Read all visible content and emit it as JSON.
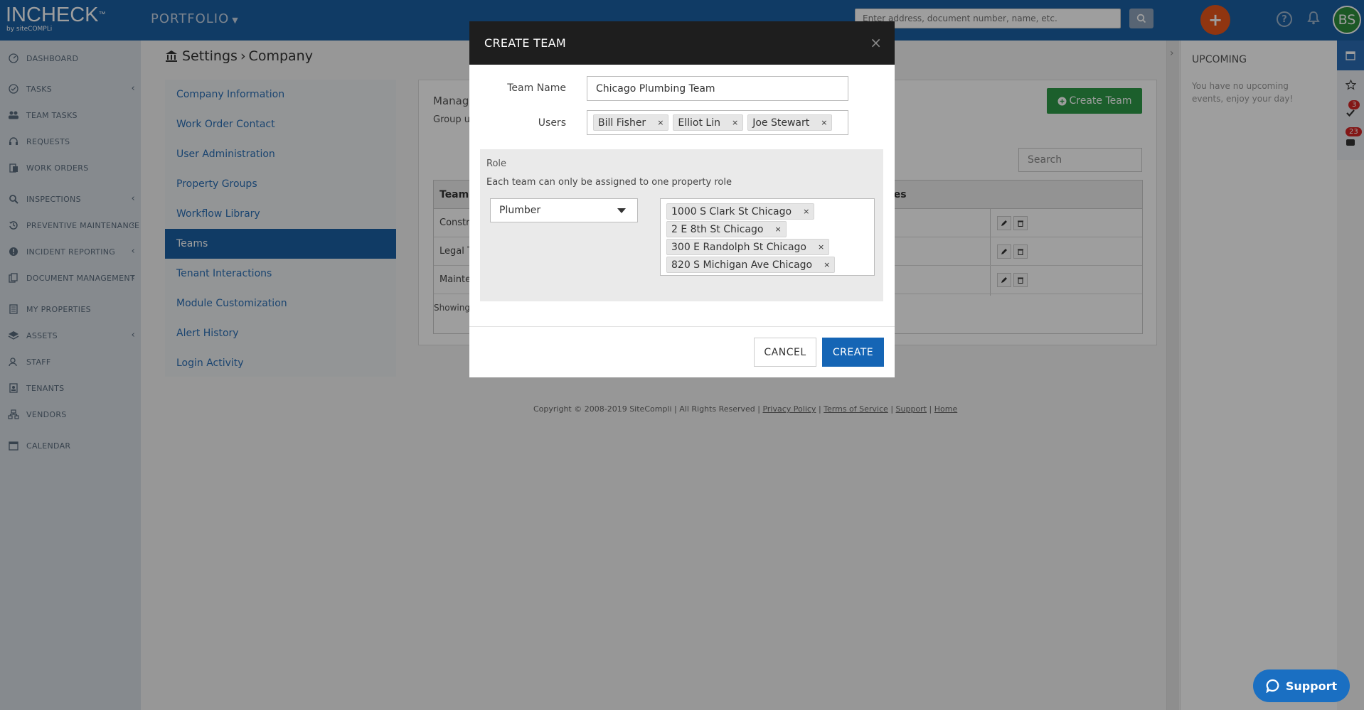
{
  "header": {
    "brand": "INCHECK",
    "brand_tm": "™",
    "brand_sub": "by siteCOMPLi",
    "portfolio": "PORTFOLIO",
    "search_placeholder": "Enter address, document number, name, etc.",
    "avatar_initials": "BS",
    "colors": {
      "topbar": "#1a5fa3",
      "add_button": "#e8561b",
      "avatar": "#2e8f3d"
    }
  },
  "nav": {
    "items": [
      {
        "label": "DASHBOARD",
        "icon": "dashboard-icon"
      },
      {
        "label": "TASKS",
        "icon": "check-circle-icon"
      },
      {
        "label": "TEAM TASKS",
        "icon": "users-icon"
      },
      {
        "label": "REQUESTS",
        "icon": "headset-icon"
      },
      {
        "label": "WORK ORDERS",
        "icon": "clipboard-icon"
      },
      {
        "label": "INSPECTIONS",
        "icon": "search-icon"
      },
      {
        "label": "PREVENTIVE MAINTENANCE",
        "icon": "history-icon"
      },
      {
        "label": "INCIDENT REPORTING",
        "icon": "alert-icon"
      },
      {
        "label": "DOCUMENT MANAGEMENT",
        "icon": "document-icon"
      },
      {
        "label": "MY PROPERTIES",
        "icon": "building-icon"
      },
      {
        "label": "ASSETS",
        "icon": "layers-icon"
      },
      {
        "label": "STAFF",
        "icon": "user-icon"
      },
      {
        "label": "TENANTS",
        "icon": "id-card-icon"
      },
      {
        "label": "VENDORS",
        "icon": "sitemap-icon"
      },
      {
        "label": "CALENDAR",
        "icon": "calendar-icon"
      }
    ]
  },
  "page": {
    "title_prefix": "Settings",
    "title_sep": "›",
    "title_current": "Company"
  },
  "settings_menu": {
    "items": [
      "Company Information",
      "Work Order Contact",
      "User Administration",
      "Property Groups",
      "Workflow Library",
      "Teams",
      "Tenant Interactions",
      "Module Customization",
      "Alert History",
      "Login Activity"
    ],
    "active": "Teams"
  },
  "teams_panel": {
    "heading": "Manag",
    "subheading": "Group u",
    "create_button": "Create Team",
    "search_placeholder": "Search",
    "col_team": "Team",
    "col_roles": "les",
    "rows": [
      "Constr",
      "Legal T",
      "Mainte"
    ],
    "showing": "Showing"
  },
  "footer": {
    "copyright": "Copyright © 2008-2019 SiteCompli | All Rights Reserved |",
    "links": [
      "Privacy Policy",
      "Terms of Service",
      "Support",
      "Home"
    ],
    "sep": "|"
  },
  "upcoming": {
    "title": "UPCOMING",
    "empty_text": "You have no upcoming events, enjoy your day!",
    "badges": [
      "3",
      "23"
    ]
  },
  "modal": {
    "title": "CREATE TEAM",
    "team_name_label": "Team Name",
    "team_name_value": "Chicago Plumbing Team",
    "users_label": "Users",
    "users": [
      "Bill Fisher",
      "Elliot Lin",
      "Joe Stewart"
    ],
    "role_label": "Role",
    "role_desc": "Each team can only be assigned to one property role",
    "role_value": "Plumber",
    "properties": [
      "1000 S Clark St Chicago",
      "2 E 8th St Chicago",
      "300 E Randolph St Chicago",
      "820 S Michigan Ave Chicago"
    ],
    "remove_glyph": "×",
    "cancel": "CANCEL",
    "create": "CREATE"
  },
  "support": {
    "label": "Support"
  }
}
